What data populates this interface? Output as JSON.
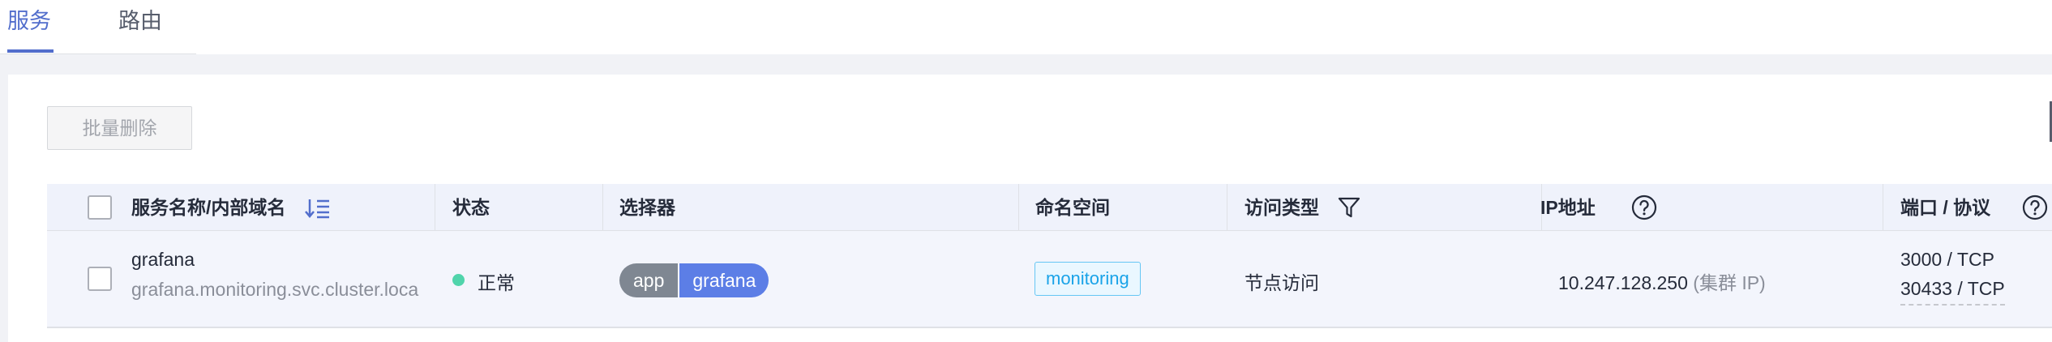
{
  "tabs": [
    {
      "label": "服务",
      "active": true
    },
    {
      "label": "路由",
      "active": false
    }
  ],
  "toolbar": {
    "batch_delete_label": "批量删除"
  },
  "table": {
    "columns": {
      "name": "服务名称/内部域名",
      "status": "状态",
      "selector": "选择器",
      "namespace": "命名空间",
      "access_type": "访问类型",
      "ip": "IP地址",
      "port": "端口 / 协议"
    },
    "rows": [
      {
        "name": "grafana",
        "domain": "grafana.monitoring.svc.cluster.loca",
        "status": "正常",
        "selector_key": "app",
        "selector_value": "grafana",
        "namespace": "monitoring",
        "access_type": "节点访问",
        "ip": "10.247.128.250",
        "ip_note": "(集群 IP)",
        "ports": [
          "3000 / TCP",
          "30433 / TCP"
        ]
      }
    ]
  },
  "colors": {
    "accent": "#526ecc",
    "status_normal": "#50d4ab",
    "selector_value_bg": "#5c7ee6",
    "namespace_tag": "#1aa3e8"
  },
  "icons": {
    "sort": "sort-desc-icon",
    "filter": "filter-icon",
    "help": "question-circle-icon"
  }
}
